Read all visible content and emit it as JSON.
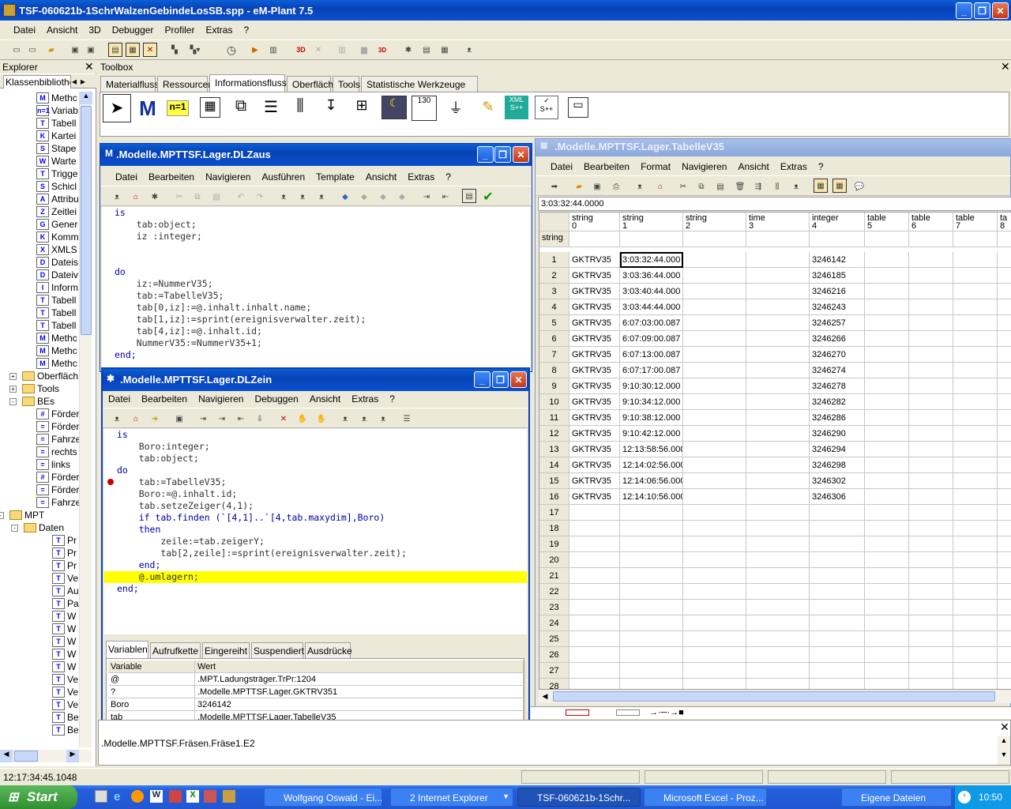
{
  "app": {
    "title": "TSF-060621b-1SchrWalzenGebindeLosSB.spp - eM-Plant 7.5",
    "menu": [
      "Datei",
      "Ansicht",
      "3D",
      "Debugger",
      "Profiler",
      "Extras",
      "?"
    ]
  },
  "explorer": {
    "title": "Explorer",
    "tab": "Klassenbibliothek",
    "items": [
      {
        "label": "Methc",
        "icon": "M",
        "indent": 46
      },
      {
        "label": "Variab",
        "icon": "n=1",
        "indent": 46
      },
      {
        "label": "Tabell",
        "icon": "T",
        "indent": 46
      },
      {
        "label": "Kartei",
        "icon": "K",
        "indent": 46
      },
      {
        "label": "Stape",
        "icon": "S",
        "indent": 46
      },
      {
        "label": "Warte",
        "icon": "W",
        "indent": 46
      },
      {
        "label": "Trigge",
        "icon": "T",
        "indent": 46
      },
      {
        "label": "Schicl",
        "icon": "S",
        "indent": 46
      },
      {
        "label": "Attribu",
        "icon": "A",
        "indent": 46
      },
      {
        "label": "Zeitlei",
        "icon": "Z",
        "indent": 46
      },
      {
        "label": "Gener",
        "icon": "G",
        "indent": 46
      },
      {
        "label": "Komm",
        "icon": "K",
        "indent": 46
      },
      {
        "label": "XMLS",
        "icon": "X",
        "indent": 46
      },
      {
        "label": "Dateis",
        "icon": "D",
        "indent": 46
      },
      {
        "label": "Dateiv",
        "icon": "D",
        "indent": 46
      },
      {
        "label": "Inform",
        "icon": "I",
        "indent": 46
      },
      {
        "label": "Tabell",
        "icon": "T",
        "indent": 46
      },
      {
        "label": "Tabell",
        "icon": "T",
        "indent": 46
      },
      {
        "label": "Tabell",
        "icon": "T",
        "indent": 46
      },
      {
        "label": "Methc",
        "icon": "M",
        "indent": 46
      },
      {
        "label": "Methc",
        "icon": "M",
        "indent": 46
      },
      {
        "label": "Methc",
        "icon": "M",
        "indent": 46
      },
      {
        "label": "Oberfläch",
        "icon": "folder",
        "indent": 28,
        "expander": "+"
      },
      {
        "label": "Tools",
        "icon": "folder",
        "indent": 28,
        "expander": "+"
      },
      {
        "label": "BEs",
        "icon": "folder",
        "indent": 28,
        "expander": "-"
      },
      {
        "label": "Förder",
        "icon": "#",
        "indent": 46
      },
      {
        "label": "Förder",
        "icon": "=",
        "indent": 46
      },
      {
        "label": "Fahrze",
        "icon": "=",
        "indent": 46
      },
      {
        "label": "rechts",
        "icon": "=",
        "indent": 46
      },
      {
        "label": "links",
        "icon": "=",
        "indent": 46
      },
      {
        "label": "Förder",
        "icon": "#",
        "indent": 46
      },
      {
        "label": "Förder",
        "icon": "=",
        "indent": 46
      },
      {
        "label": "Fahrze",
        "icon": "=",
        "indent": 46
      },
      {
        "label": "MPT",
        "icon": "folder",
        "indent": 12,
        "expander": "-"
      },
      {
        "label": "Daten",
        "icon": "folder",
        "indent": 30,
        "expander": "-"
      },
      {
        "label": "Pr",
        "icon": "T",
        "indent": 66
      },
      {
        "label": "Pr",
        "icon": "T",
        "indent": 66
      },
      {
        "label": "Pr",
        "icon": "T",
        "indent": 66
      },
      {
        "label": "Ve",
        "icon": "T",
        "indent": 66
      },
      {
        "label": "Au",
        "icon": "T",
        "indent": 66
      },
      {
        "label": "Pa",
        "icon": "T",
        "indent": 66
      },
      {
        "label": "W",
        "icon": "T",
        "indent": 66
      },
      {
        "label": "W",
        "icon": "T",
        "indent": 66
      },
      {
        "label": "W",
        "icon": "T",
        "indent": 66
      },
      {
        "label": "W",
        "icon": "T",
        "indent": 66
      },
      {
        "label": "W",
        "icon": "T",
        "indent": 66
      },
      {
        "label": "Ve",
        "icon": "T",
        "indent": 66
      },
      {
        "label": "Ve",
        "icon": "T",
        "indent": 66
      },
      {
        "label": "Ve",
        "icon": "T",
        "indent": 66
      },
      {
        "label": "Be",
        "icon": "T",
        "indent": 66
      },
      {
        "label": "Be",
        "icon": "T",
        "indent": 66
      }
    ]
  },
  "toolbox": {
    "title": "Toolbox",
    "tabs": [
      "Materialfluss",
      "Ressourcen",
      "Informationsfluss",
      "Oberfläche",
      "Tools",
      "Statistische Werkzeuge"
    ],
    "active": 2
  },
  "dlzaus": {
    "title": ".Modelle.MPTTSF.Lager.DLZaus",
    "menu": [
      "Datei",
      "Bearbeiten",
      "Navigieren",
      "Ausführen",
      "Template",
      "Ansicht",
      "Extras",
      "?"
    ],
    "code": [
      "is",
      "    tab:object;",
      "    iz :integer;",
      "",
      "",
      "do",
      "    iz:=NummerV35;",
      "    tab:=TabelleV35;",
      "    tab[0,iz]:=@.inhalt.inhalt.name;",
      "    tab[1,iz]:=sprint(ereignisverwalter.zeit);",
      "    tab[4,iz]:=@.inhalt.id;",
      "    NummerV35:=NummerV35+1;",
      "end;"
    ]
  },
  "dlzein": {
    "title": ".Modelle.MPTTSF.Lager.DLZein",
    "menu": [
      "Datei",
      "Bearbeiten",
      "Navigieren",
      "Debuggen",
      "Ansicht",
      "Extras",
      "?"
    ],
    "code": [
      "is",
      "    Boro:integer;",
      "    tab:object;",
      "do",
      "    tab:=TabelleV35;",
      "    Boro:=@.inhalt.id;",
      "    tab.setzeZeiger(4,1);",
      "    if tab.finden (`[4,1]..`[4,tab.maxydim],Boro)",
      "    then",
      "        zeile:=tab.zeigerY;",
      "        tab[2,zeile]:=sprint(ereignisverwalter.zeit);",
      "    end;",
      "    @.umlagern;",
      "end;"
    ],
    "highlight_line": 12,
    "breakpoint_line": 4,
    "tabs": [
      "Variablen",
      "Aufrufkette",
      "Eingereiht",
      "Suspendiert",
      "Ausdrücke"
    ],
    "var_headers": [
      "Variable",
      "Wert"
    ],
    "vars": [
      [
        "@",
        ".MPT.Ladungsträger.TrPr:1204"
      ],
      [
        "?",
        ".Modelle.MPTTSF.Lager.GKTRV351"
      ],
      [
        "Boro",
        "3246142"
      ],
      [
        "tab",
        ".Modelle.MPTTSF.Lager.TabelleV35"
      ]
    ]
  },
  "table": {
    "title": ".Modelle.MPTTSF.Lager.TabelleV35",
    "menu": [
      "Datei",
      "Bearbeiten",
      "Format",
      "Navigieren",
      "Ansicht",
      "Extras",
      "?"
    ],
    "edit_value": "3:03:32:44.0000",
    "col_types": [
      "string",
      "string",
      "string",
      "time",
      "integer",
      "table",
      "table",
      "table",
      "ta"
    ],
    "col_idx": [
      "0",
      "1",
      "2",
      "3",
      "4",
      "5",
      "6",
      "7",
      "8"
    ],
    "row_header_type": "string",
    "rows": [
      [
        "GKTRV35",
        "3:03:32:44.000",
        "",
        "",
        "3246142"
      ],
      [
        "GKTRV35",
        "3:03:36:44.000",
        "",
        "",
        "3246185"
      ],
      [
        "GKTRV35",
        "3:03:40:44.000",
        "",
        "",
        "3246216"
      ],
      [
        "GKTRV35",
        "3:03:44:44.000",
        "",
        "",
        "3246243"
      ],
      [
        "GKTRV35",
        "6:07:03:00.087",
        "",
        "",
        "3246257"
      ],
      [
        "GKTRV35",
        "6:07:09:00.087",
        "",
        "",
        "3246266"
      ],
      [
        "GKTRV35",
        "6:07:13:00.087",
        "",
        "",
        "3246270"
      ],
      [
        "GKTRV35",
        "6:07:17:00.087",
        "",
        "",
        "3246274"
      ],
      [
        "GKTRV35",
        "9:10:30:12.000",
        "",
        "",
        "3246278"
      ],
      [
        "GKTRV35",
        "9:10:34:12.000",
        "",
        "",
        "3246282"
      ],
      [
        "GKTRV35",
        "9:10:38:12.000",
        "",
        "",
        "3246286"
      ],
      [
        "GKTRV35",
        "9:10:42:12.000",
        "",
        "",
        "3246290"
      ],
      [
        "GKTRV35",
        "12:13:58:56.000",
        "",
        "",
        "3246294"
      ],
      [
        "GKTRV35",
        "12:14:02:56.000",
        "",
        "",
        "3246298"
      ],
      [
        "GKTRV35",
        "12:14:06:56.000",
        "",
        "",
        "3246302"
      ],
      [
        "GKTRV35",
        "12:14:10:56.000",
        "",
        "",
        "3246306"
      ]
    ],
    "total_rows": 28
  },
  "console": {
    "line": ".Modelle.MPTTSF.Fräsen.Fräse1.E2"
  },
  "status": {
    "time": "12:17:34:45.1048"
  },
  "taskbar": {
    "start": "Start",
    "clock": "10:50",
    "buttons": [
      "Wolfgang Oswald - Ei...",
      "2 Internet Explorer",
      "TSF-060621b-1Schr...",
      "Microsoft Excel - Proz...",
      "Eigene Dateien"
    ]
  }
}
